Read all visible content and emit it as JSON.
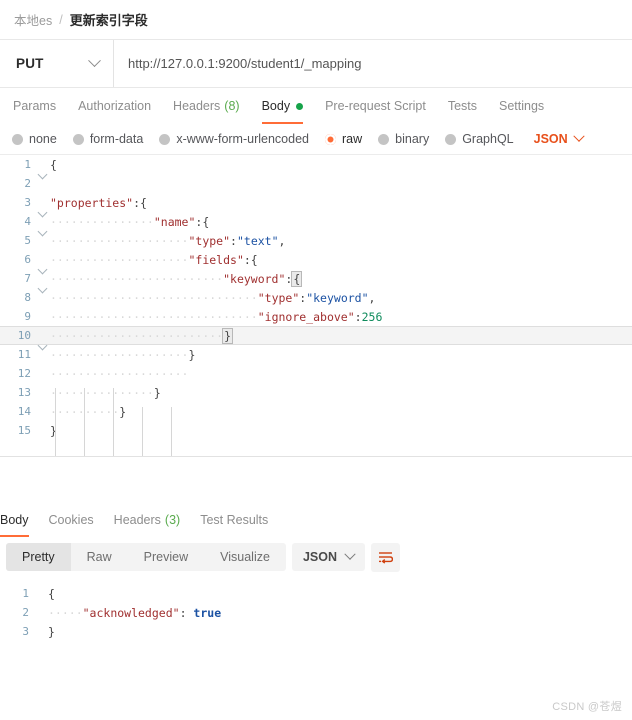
{
  "breadcrumb": {
    "parent": "本地es",
    "separator": "/",
    "current": "更新索引字段"
  },
  "request": {
    "method": "PUT",
    "url": "http://127.0.0.1:9200/student1/_mapping",
    "tabs": [
      {
        "label": "Params",
        "active": false
      },
      {
        "label": "Authorization",
        "active": false
      },
      {
        "label": "Headers",
        "count": "(8)",
        "active": false
      },
      {
        "label": "Body",
        "active": true,
        "dot": true
      },
      {
        "label": "Pre-request Script",
        "active": false
      },
      {
        "label": "Tests",
        "active": false
      },
      {
        "label": "Settings",
        "active": false
      }
    ],
    "body_types": [
      {
        "label": "none",
        "selected": false
      },
      {
        "label": "form-data",
        "selected": false
      },
      {
        "label": "x-www-form-urlencoded",
        "selected": false
      },
      {
        "label": "raw",
        "selected": true
      },
      {
        "label": "binary",
        "selected": false
      },
      {
        "label": "GraphQL",
        "selected": false
      }
    ],
    "raw_format": "JSON",
    "body_lines": [
      {
        "num": "1",
        "fold": true,
        "indent": 0,
        "text": "{"
      },
      {
        "num": "2",
        "fold": false,
        "indent": 0,
        "text": ""
      },
      {
        "num": "3",
        "fold": true,
        "indent": 0,
        "key": "\"properties\"",
        "after": ":{"
      },
      {
        "num": "4",
        "fold": true,
        "indent": 3,
        "key": "\"name\"",
        "after": ":{"
      },
      {
        "num": "5",
        "fold": false,
        "indent": 4,
        "key": "\"type\"",
        "colon": ":",
        "val": "\"text\"",
        "after": ","
      },
      {
        "num": "6",
        "fold": true,
        "indent": 4,
        "key": "\"fields\"",
        "after": ":{"
      },
      {
        "num": "7",
        "fold": true,
        "indent": 5,
        "key": "\"keyword\"",
        "colon": ":",
        "brace": "{"
      },
      {
        "num": "8",
        "fold": false,
        "indent": 6,
        "key": "\"type\"",
        "colon": ":",
        "val": "\"keyword\"",
        "after": ","
      },
      {
        "num": "9",
        "fold": false,
        "indent": 6,
        "key": "\"ignore_above\"",
        "colon": ":",
        "num_val": "256"
      },
      {
        "num": "10",
        "fold": true,
        "indent": 5,
        "brace": "}",
        "highlight": true
      },
      {
        "num": "11",
        "fold": false,
        "indent": 4,
        "text": "}"
      },
      {
        "num": "12",
        "fold": false,
        "indent": 4,
        "text": ""
      },
      {
        "num": "13",
        "fold": false,
        "indent": 3,
        "text": "}"
      },
      {
        "num": "14",
        "fold": false,
        "indent": 2,
        "text": "}"
      },
      {
        "num": "15",
        "fold": false,
        "indent": 0,
        "text": "}"
      }
    ]
  },
  "response": {
    "tabs": [
      {
        "label": "Body",
        "active": true
      },
      {
        "label": "Cookies",
        "active": false
      },
      {
        "label": "Headers",
        "count": "(3)",
        "active": false
      },
      {
        "label": "Test Results",
        "active": false
      }
    ],
    "view_modes": [
      {
        "label": "Pretty",
        "active": true
      },
      {
        "label": "Raw",
        "active": false
      },
      {
        "label": "Preview",
        "active": false
      },
      {
        "label": "Visualize",
        "active": false
      }
    ],
    "format": "JSON",
    "wrap_icon": "word-wrap-icon",
    "body_lines": [
      {
        "num": "1",
        "brace": "{"
      },
      {
        "num": "2",
        "indent": 1,
        "key": "\"acknowledged\"",
        "colon": ":",
        "bool": "true"
      },
      {
        "num": "3",
        "brace": "}"
      }
    ]
  },
  "watermark": "CSDN @苍煜",
  "colors": {
    "accent": "#ff6c37",
    "accent_dark": "#e8501b",
    "green": "#5aab4e",
    "key": "#a03030",
    "string": "#1c52a3",
    "number": "#0f8b5c"
  }
}
